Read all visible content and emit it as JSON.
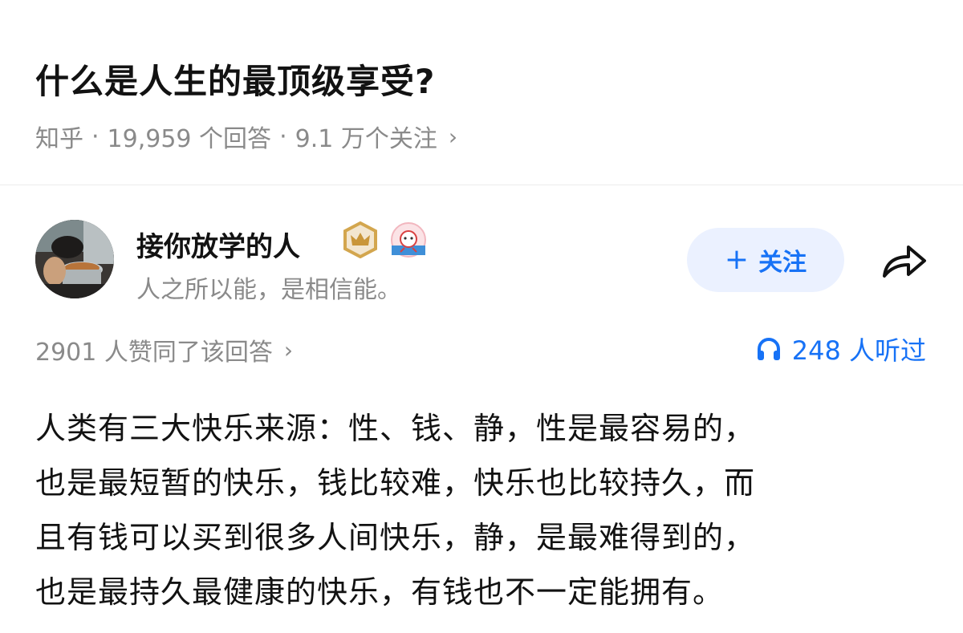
{
  "question": {
    "title": "什么是人生的最顶级享受?",
    "source": "知乎",
    "answers": "19,959 个回答",
    "followers": "9.1 万个关注",
    "separator": "·",
    "chevron": "›"
  },
  "author": {
    "name": "接你放学的人",
    "bio": "人之所以能，是相信能。",
    "avatar_icon": "avatar-photo",
    "badges": [
      "crown-badge-icon",
      "lion-badge-icon"
    ]
  },
  "actions": {
    "follow_plus": "+",
    "follow_label": "关注",
    "share_icon": "share-icon"
  },
  "stats": {
    "upvotes": "2901 人赞同了该回答",
    "chevron": "›",
    "listened": "248 人听过",
    "listen_icon": "headphones-icon"
  },
  "answer": {
    "lines": [
      "人类有三大快乐来源：性、钱、静，性是最容易的，",
      "也是最短暂的快乐，钱比较难，快乐也比较持久，而",
      "且有钱可以买到很多人间快乐，静，是最难得到的，",
      "也是最持久最健康的快乐，有钱也不一定能拥有。"
    ]
  },
  "colors": {
    "brand_blue": "#1772f6",
    "follow_bg": "#ebf1ff",
    "muted": "#8a8a8a",
    "text": "#121212"
  }
}
